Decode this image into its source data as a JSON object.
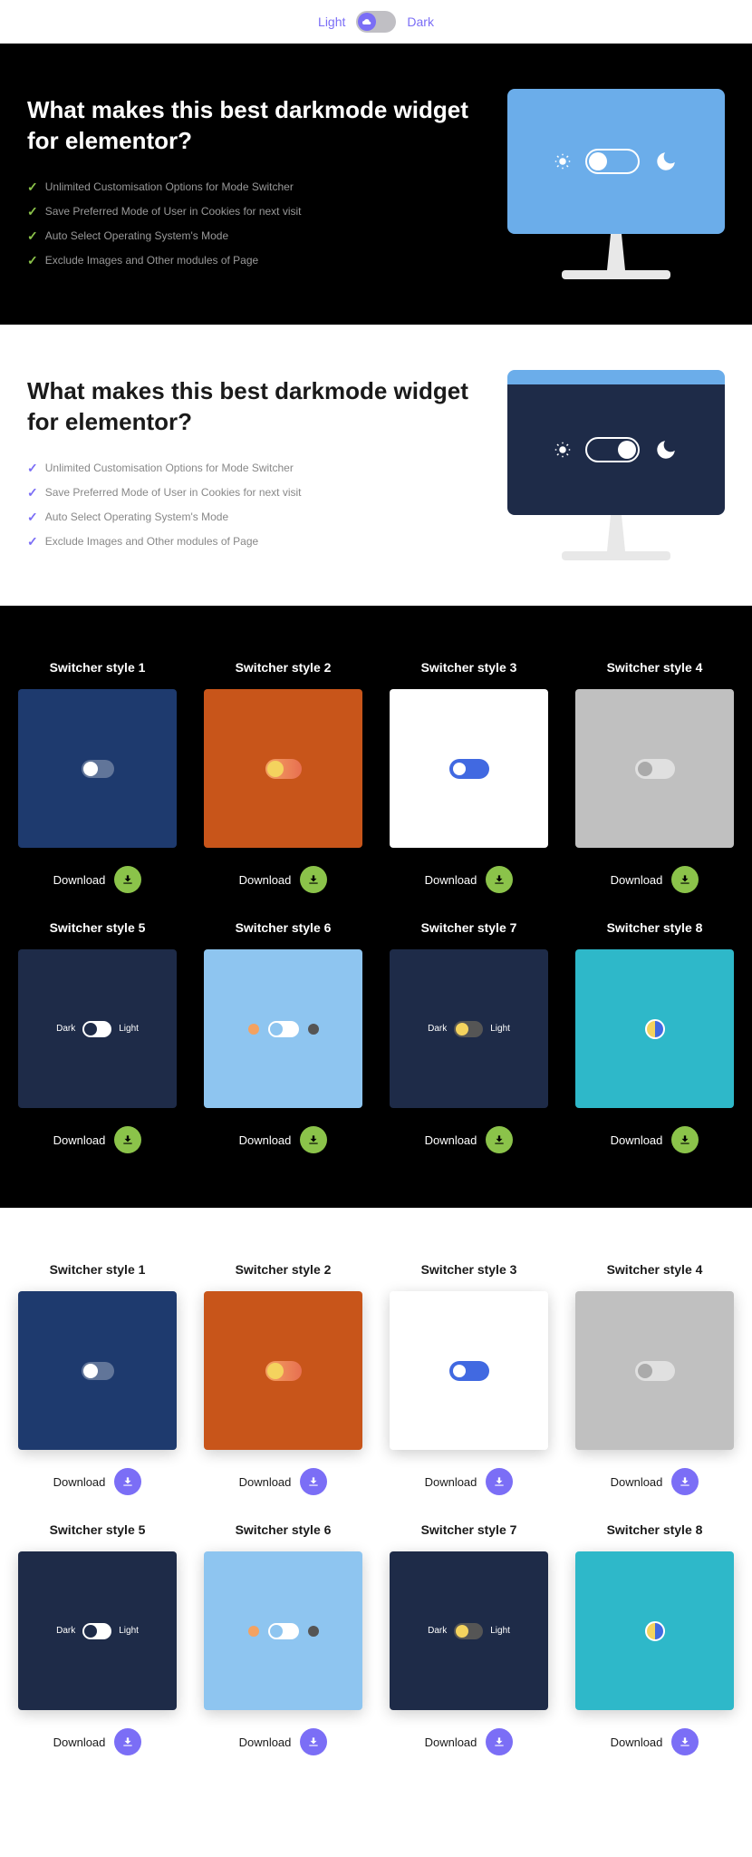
{
  "topSwitch": {
    "light": "Light",
    "dark": "Dark"
  },
  "hero": {
    "title": "What makes this best darkmode widget for elementor?",
    "features": [
      "Unlimited Customisation Options for Mode Switcher",
      "Save Preferred Mode of User in Cookies for next visit",
      "Auto Select Operating System's Mode",
      "Exclude Images and Other modules of Page"
    ]
  },
  "switchers": [
    {
      "title": "Switcher style 1",
      "preview": "c1",
      "sw": "sw1"
    },
    {
      "title": "Switcher style 2",
      "preview": "c2",
      "sw": "sw2"
    },
    {
      "title": "Switcher style 3",
      "preview": "c3",
      "sw": "sw3"
    },
    {
      "title": "Switcher style 4",
      "preview": "c4",
      "sw": "sw4"
    },
    {
      "title": "Switcher style 5",
      "preview": "c5",
      "sw": "sw5"
    },
    {
      "title": "Switcher style 6",
      "preview": "c6",
      "sw": "sw6"
    },
    {
      "title": "Switcher style 7",
      "preview": "c7",
      "sw": "sw7"
    },
    {
      "title": "Switcher style 8",
      "preview": "c8",
      "sw": "sw8"
    }
  ],
  "labels": {
    "download": "Download",
    "dark": "Dark",
    "light": "Light"
  },
  "colors": {
    "accentGreen": "#8bc34a",
    "accentPurple": "#7b6ef6"
  }
}
